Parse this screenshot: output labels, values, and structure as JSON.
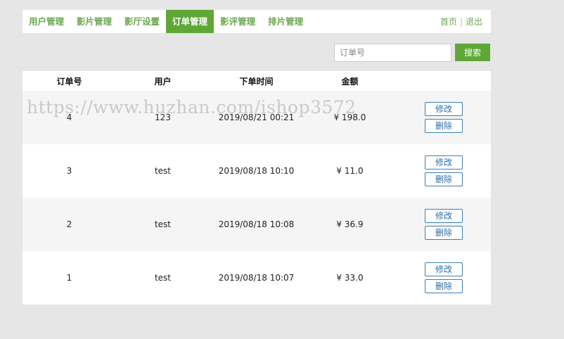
{
  "nav": {
    "items": [
      {
        "label": "用户管理",
        "active": false
      },
      {
        "label": "影片管理",
        "active": false
      },
      {
        "label": "影厅设置",
        "active": false
      },
      {
        "label": "订单管理",
        "active": true
      },
      {
        "label": "影评管理",
        "active": false
      },
      {
        "label": "排片管理",
        "active": false
      }
    ],
    "home_label": "首页",
    "separator": "|",
    "logout_label": "退出"
  },
  "search": {
    "placeholder": "订单号",
    "button_label": "搜索"
  },
  "table": {
    "headers": [
      "订单号",
      "用户",
      "下单时间",
      "金额"
    ],
    "rows": [
      {
        "id": "4",
        "user": "123",
        "time": "2019/08/21 00:21",
        "amount": "¥ 198.0",
        "edit": "修改",
        "delete": "删除"
      },
      {
        "id": "3",
        "user": "test",
        "time": "2019/08/18 10:10",
        "amount": "¥ 11.0",
        "edit": "修改",
        "delete": "删除"
      },
      {
        "id": "2",
        "user": "test",
        "time": "2019/08/18 10:08",
        "amount": "¥ 36.9",
        "edit": "修改",
        "delete": "删除"
      },
      {
        "id": "1",
        "user": "test",
        "time": "2019/08/18 10:07",
        "amount": "¥ 33.0",
        "edit": "修改",
        "delete": "删除"
      }
    ]
  },
  "watermark": "https://www.huzhan.com/ishop3572",
  "colors": {
    "accent": "#5fa836",
    "nav_text": "#6aa84f",
    "button_border": "#3d7fb0",
    "background": "#e6e6e6"
  }
}
